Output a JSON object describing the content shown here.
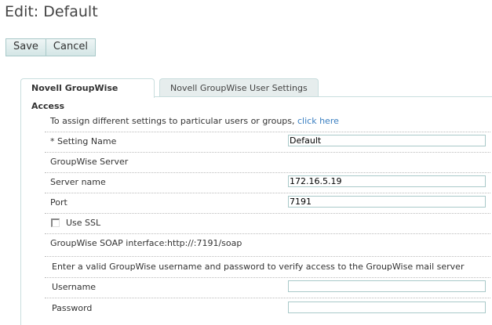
{
  "title": "Edit: Default",
  "toolbar": {
    "save": "Save",
    "cancel": "Cancel"
  },
  "tabs": [
    "Novell GroupWise Access",
    "Novell GroupWise User Settings"
  ],
  "form": {
    "assign_text": "To assign different settings to particular users or groups,",
    "assign_link": "click here",
    "setting_name_label": "* Setting Name",
    "setting_name_value": "Default",
    "server_section": "GroupWise Server",
    "server_name_label": "Server name",
    "server_name_value": "172.16.5.19",
    "port_label": "Port",
    "port_value": "7191",
    "ssl_label": "Use SSL",
    "soap_text": "GroupWise SOAP interface:http://:7191/soap",
    "verify_text": "Enter a valid GroupWise username and password to verify access to the GroupWise mail server",
    "username_label": "Username",
    "username_value": "",
    "password_label": "Password",
    "password_value": ""
  }
}
